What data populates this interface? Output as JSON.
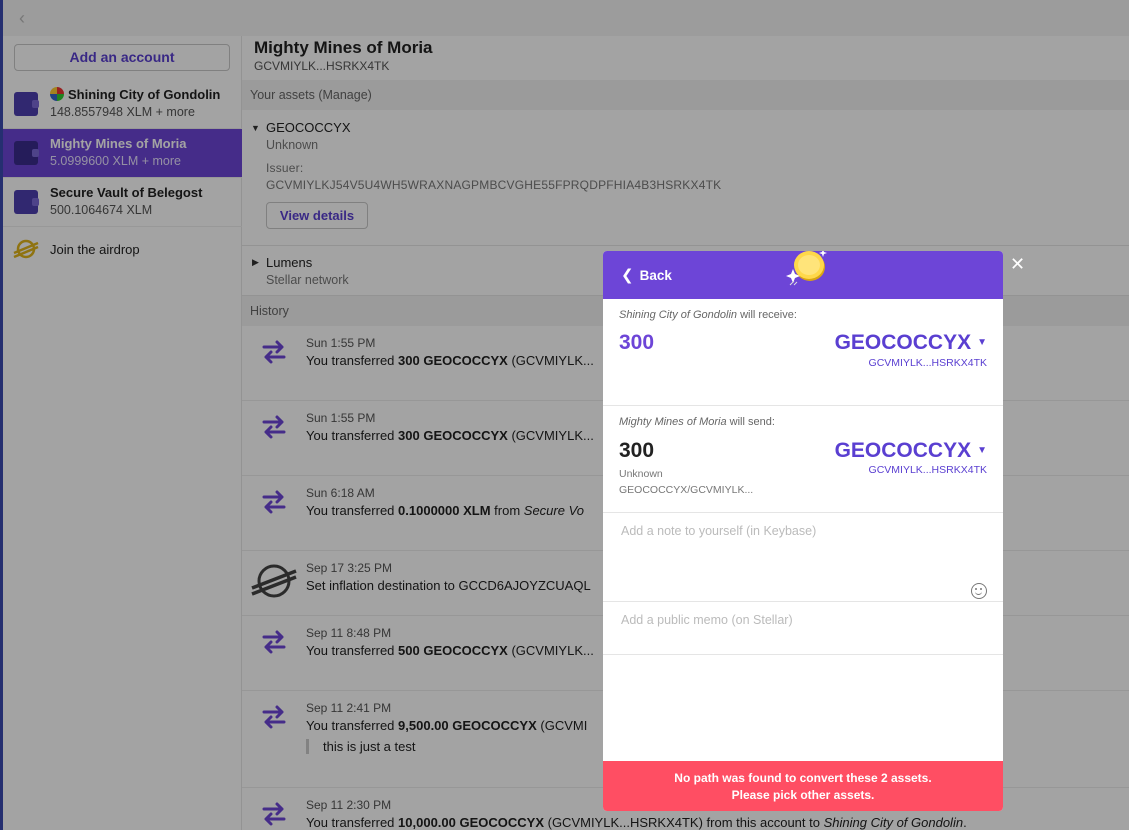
{
  "sidebar": {
    "add_account_label": "Add an account",
    "accounts": [
      {
        "name": "Shining City of Gondolin",
        "balance": "148.8557948 XLM + more"
      },
      {
        "name": "Mighty Mines of Moria",
        "balance": "5.0999600 XLM + more"
      },
      {
        "name": "Secure Vault of Belegost",
        "balance": "500.1064674 XLM"
      }
    ],
    "airdrop_label": "Join the airdrop"
  },
  "main": {
    "title": "Mighty Mines of Moria",
    "account_id": "GCVMIYLK...HSRKX4TK",
    "assets_header": "Your assets (Manage)",
    "assets": [
      {
        "code": "GEOCOCCYX",
        "sub": "Unknown",
        "issuer_label": "Issuer:",
        "issuer": "GCVMIYLKJ54V5U4WH5WRAXNAGPMBCVGHE55FPRQDPFHIA4B3HSRKX4TK",
        "view_details": "View details"
      },
      {
        "code": "Lumens",
        "sub": "Stellar network"
      }
    ],
    "history_header": "History",
    "history": [
      {
        "time": "Sun 1:55 PM",
        "prefix": "You transferred ",
        "amount": "300 GEOCOCCYX",
        "suffix": " (GCVMIYLK..."
      },
      {
        "time": "Sun 1:55 PM",
        "prefix": "You transferred ",
        "amount": "300 GEOCOCCYX",
        "suffix": " (GCVMIYLK..."
      },
      {
        "time": "Sun 6:18 AM",
        "prefix": "You transferred ",
        "amount": "0.1000000 XLM",
        "suffix": " from ",
        "target": "Secure Vo"
      },
      {
        "time": "Sep 17 3:25 PM",
        "text": "Set inflation destination to GCCD6AJOYZCUAQL"
      },
      {
        "time": "Sep 11 8:48 PM",
        "prefix": "You transferred ",
        "amount": "500 GEOCOCCYX",
        "suffix": " (GCVMIYLK..."
      },
      {
        "time": "Sep 11 2:41 PM",
        "prefix": "You transferred ",
        "amount": "9,500.00 GEOCOCCYX",
        "suffix": " (GCVMI",
        "memo": "this is just a test"
      },
      {
        "time": "Sep 11 2:30 PM",
        "prefix": "You transferred ",
        "amount": "10,000.00 GEOCOCCYX",
        "suffix": " (GCVMIYLK...HSRKX4TK) from this account to ",
        "target": "Shining City of Gondolin",
        "end": "."
      }
    ]
  },
  "modal": {
    "back_label": "Back",
    "receive_name": "Shining City of Gondolin",
    "receive_suffix": " will receive:",
    "receive_amount": "300",
    "receive_asset": "GEOCOCCYX",
    "receive_issuer": "GCVMIYLK...HSRKX4TK",
    "send_name": "Mighty Mines of Moria",
    "send_suffix": " will send:",
    "send_amount": "300",
    "send_unknown": "Unknown",
    "send_path": "GEOCOCCYX/GCVMIYLK...",
    "send_asset": "GEOCOCCYX",
    "send_issuer": "GCVMIYLK...HSRKX4TK",
    "note_placeholder": "Add a note to yourself (in Keybase)",
    "memo_placeholder": "Add a public memo (on Stellar)",
    "error_line1": "No path was found to convert these 2 assets.",
    "error_line2": "Please pick other assets."
  },
  "colors": {
    "accent": "#6d45d7",
    "error": "#ff4e63"
  }
}
